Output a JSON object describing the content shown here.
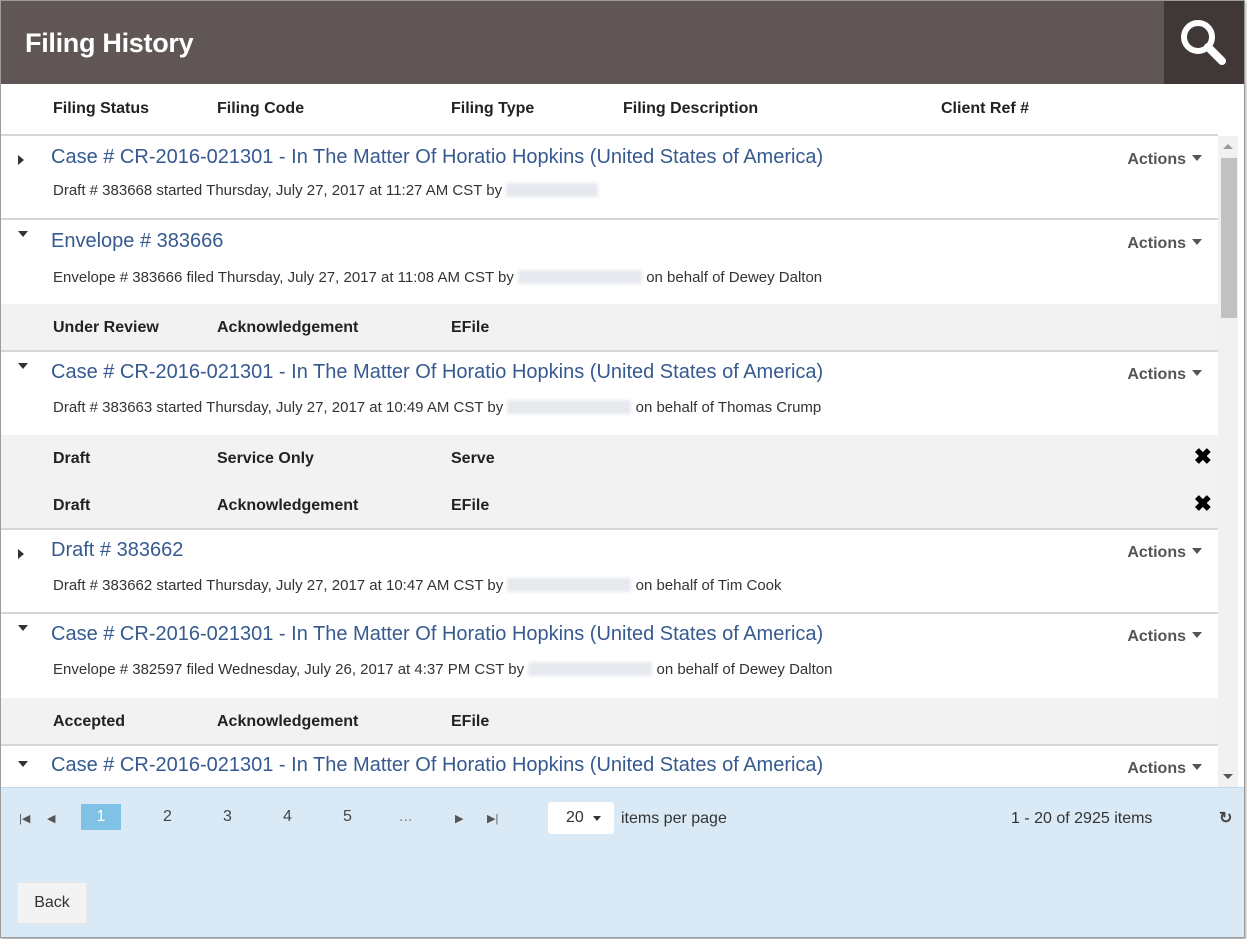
{
  "header": {
    "title": "Filing History",
    "search_icon": "search-icon"
  },
  "columns": [
    "Filing Status",
    "Filing Code",
    "Filing Type",
    "Filing Description",
    "Client Ref #"
  ],
  "actions_label": "Actions",
  "rows": [
    {
      "expanded": false,
      "title": "Case # CR-2016-021301 - In The Matter Of Horatio Hopkins (United States of America)",
      "sub_prefix": "Draft # 383668 started Thursday, July 27, 2017 at 11:27 AM CST by",
      "sub_suffix": "",
      "filings": []
    },
    {
      "expanded": true,
      "title": "Envelope # 383666",
      "sub_prefix": "Envelope # 383666 filed Thursday, July 27, 2017 at 11:08 AM CST by",
      "sub_suffix": "on behalf of Dewey Dalton",
      "filings": [
        {
          "status": "Under Review",
          "code": "Acknowledgement",
          "type": "EFile",
          "removable": false
        }
      ]
    },
    {
      "expanded": true,
      "title": "Case # CR-2016-021301 - In The Matter Of Horatio Hopkins (United States of America)",
      "sub_prefix": "Draft # 383663 started Thursday, July 27, 2017 at 10:49 AM CST by",
      "sub_suffix": "on behalf of Thomas Crump",
      "filings": [
        {
          "status": "Draft",
          "code": "Service Only",
          "type": "Serve",
          "removable": true
        },
        {
          "status": "Draft",
          "code": "Acknowledgement",
          "type": "EFile",
          "removable": true
        }
      ]
    },
    {
      "expanded": false,
      "title": "Draft # 383662",
      "sub_prefix": "Draft # 383662 started Thursday, July 27, 2017 at 10:47 AM CST by",
      "sub_suffix": "on behalf of Tim Cook",
      "filings": []
    },
    {
      "expanded": true,
      "title": "Case # CR-2016-021301 - In The Matter Of Horatio Hopkins (United States of America)",
      "sub_prefix": "Envelope # 382597 filed Wednesday, July 26, 2017 at 4:37 PM CST by",
      "sub_suffix": "on behalf of Dewey Dalton",
      "filings": [
        {
          "status": "Accepted",
          "code": "Acknowledgement",
          "type": "EFile",
          "removable": false
        }
      ]
    },
    {
      "expanded": true,
      "title": "Case # CR-2016-021301 - In The Matter Of Horatio Hopkins (United States of America)",
      "sub_prefix": "",
      "sub_suffix": "",
      "filings": []
    }
  ],
  "pager": {
    "pages": [
      "1",
      "2",
      "3",
      "4",
      "5",
      "..."
    ],
    "current_page": "1",
    "page_size": "20",
    "items_per_page_label": "items per page",
    "count_text": "1 - 20 of 2925 items"
  },
  "footer": {
    "back_label": "Back"
  },
  "colors": {
    "header_bg": "#5f5655",
    "link": "#365a8f",
    "footer_bg": "#d9eaf6",
    "active_page": "#7fc2e6"
  }
}
